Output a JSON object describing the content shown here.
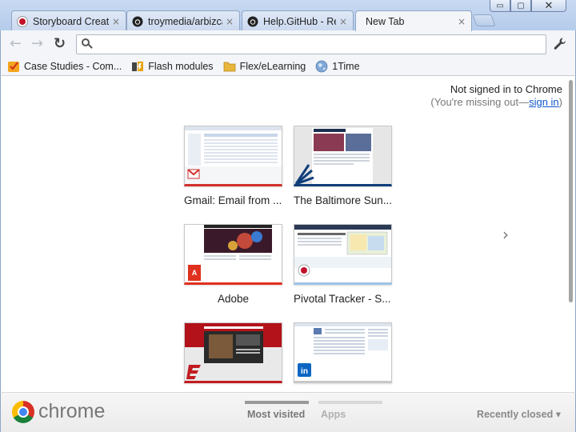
{
  "window": {
    "controls": {
      "minimize": "▭",
      "maximize": "▢",
      "close": "✕"
    }
  },
  "tabs": [
    {
      "title": "Storyboard Creato",
      "icon": "red-circle-favicon",
      "close": "×",
      "active": false
    },
    {
      "title": "troymedia/arbizca",
      "icon": "github-icon",
      "close": "×",
      "active": false
    },
    {
      "title": "Help.GitHub - Rer",
      "icon": "github-icon",
      "close": "×",
      "active": false
    },
    {
      "title": "New Tab",
      "icon": "none",
      "close": "×",
      "active": true
    }
  ],
  "toolbar": {
    "back": "←",
    "forward": "→",
    "reload": "↻",
    "omnibox_value": "",
    "omnibox_icon": "search-icon",
    "menu_icon": "wrench-icon"
  },
  "bookmarks": [
    {
      "label": "Case Studies - Com...",
      "icon": "checkmark-icon"
    },
    {
      "label": "Flash modules",
      "icon": "flash-icon"
    },
    {
      "label": "Flex/eLearning",
      "icon": "folder-icon"
    },
    {
      "label": "1Time",
      "icon": "globe-icon"
    }
  ],
  "signin": {
    "line1": "Not signed in to Chrome",
    "line2_prefix": "(You're missing out—",
    "link": "sign in",
    "line2_suffix": ")"
  },
  "thumbnails": [
    {
      "label": "Gmail: Email from ...",
      "site": "gmail"
    },
    {
      "label": "The Baltimore Sun...",
      "site": "baltimore-sun"
    },
    {
      "label": "Adobe",
      "site": "adobe"
    },
    {
      "label": "Pivotal Tracker - S...",
      "site": "pivotal-tracker"
    },
    {
      "label": "",
      "site": "espn"
    },
    {
      "label": "",
      "site": "linkedin"
    }
  ],
  "next_page": "›",
  "footer": {
    "brand": "chrome",
    "tabs": [
      {
        "label": "Most visited",
        "active": true
      },
      {
        "label": "Apps",
        "active": false
      }
    ],
    "recently_closed": "Recently closed",
    "dropdown_arrow": "▾"
  },
  "colors": {
    "link": "#1155cc",
    "gmail_red": "#d2322d",
    "adobe_red": "#e0301e",
    "espn_red": "#c21c22",
    "linkedin_blue": "#0a66c2",
    "pivotal_blue": "#9fc3e6",
    "baltimore_blue": "#0f3e7a"
  }
}
